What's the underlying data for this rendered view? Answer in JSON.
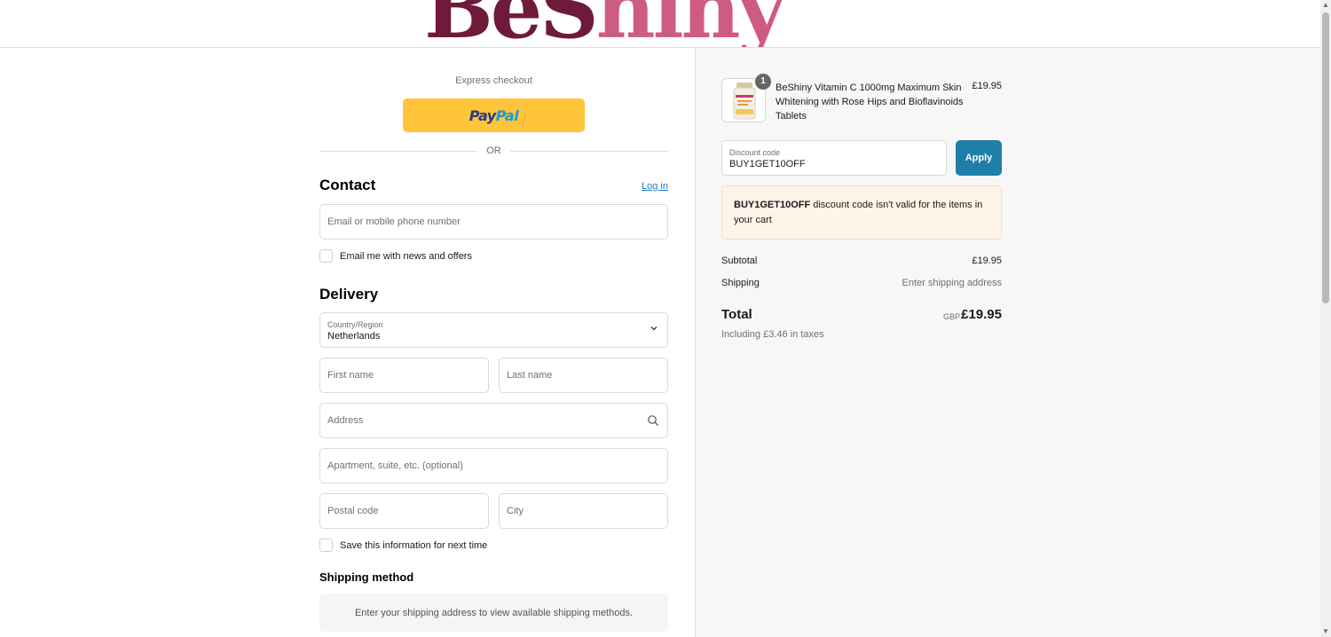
{
  "brand": {
    "logo_text_dark": "BeS",
    "logo_text_pink": "hiny"
  },
  "express": {
    "label": "Express checkout",
    "paypal_pay": "Pay",
    "paypal_pal": "Pal",
    "or": "OR"
  },
  "contact": {
    "title": "Contact",
    "login": "Log in",
    "email_placeholder": "Email or mobile phone number",
    "news_label": "Email me with news and offers"
  },
  "delivery": {
    "title": "Delivery",
    "country_label": "Country/Region",
    "country_value": "Netherlands",
    "first_name": "First name",
    "last_name": "Last name",
    "address": "Address",
    "apartment": "Apartment, suite, etc. (optional)",
    "postal": "Postal code",
    "city": "City",
    "save_label": "Save this information for next time"
  },
  "shipping": {
    "title": "Shipping method",
    "notice": "Enter your shipping address to view available shipping methods."
  },
  "summary": {
    "product": {
      "qty": "1",
      "name": "BeShiny Vitamin C 1000mg Maximum Skin Whitening with Rose Hips and Bioflavinoids Tablets",
      "price": "£19.95"
    },
    "discount": {
      "label": "Discount code",
      "value": "BUY1GET10OFF",
      "apply": "Apply"
    },
    "error": {
      "code": "BUY1GET10OFF",
      "message": " discount code isn't valid for the items in your cart"
    },
    "subtotal_label": "Subtotal",
    "subtotal_value": "£19.95",
    "shipping_label": "Shipping",
    "shipping_value": "Enter shipping address",
    "total_label": "Total",
    "currency": "GBP",
    "total_value": "£19.95",
    "taxes": "Including £3.46 in taxes"
  },
  "colors": {
    "paypal": "#ffc439",
    "apply": "#1f7ea8",
    "link": "#197bbd",
    "error_bg": "#fff4e8"
  }
}
